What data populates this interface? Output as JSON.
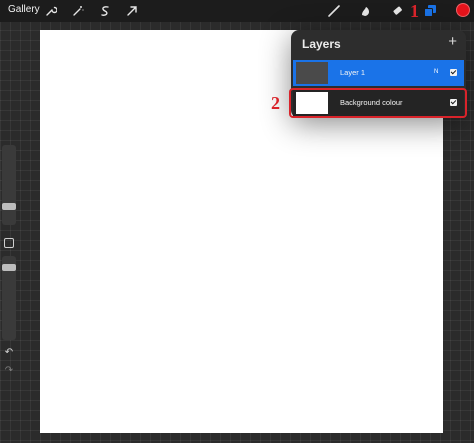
{
  "topbar": {
    "gallery_label": "Gallery",
    "left_tools": [
      "wrench-icon",
      "magic-wand-icon",
      "selection-icon",
      "transform-arrow-icon"
    ],
    "right_tools": [
      "brush-icon",
      "smudge-icon",
      "eraser-icon",
      "layers-icon"
    ],
    "color_swatch": "#e8141c"
  },
  "layers_panel": {
    "title": "Layers",
    "add_label": "+",
    "layers": [
      {
        "name": "Layer 1",
        "blend_mode": "N",
        "visible": true,
        "selected": true
      },
      {
        "name": "Background colour",
        "visible": true,
        "selected": false,
        "thumbnail_color": "#ffffff"
      }
    ]
  },
  "annotations": {
    "callout_1": "1",
    "callout_2": "2",
    "color": "#d9232a"
  },
  "sidebar": {
    "undo_label": "↶",
    "redo_label": "↷"
  },
  "colors": {
    "accent": "#1a73e8",
    "background": "#2b2b2b"
  }
}
